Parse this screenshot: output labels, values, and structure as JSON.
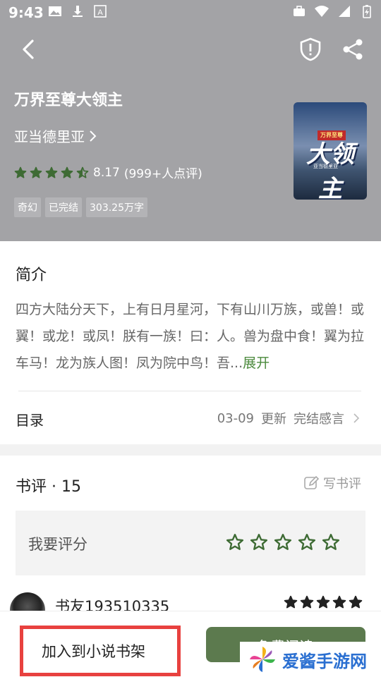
{
  "status_bar": {
    "time": "9:43"
  },
  "book": {
    "title": "万界至尊大领主",
    "author": "亚当德里亚",
    "rating_value": "8.17",
    "rating_count": "(999+人点评)",
    "rating_stars": 4.5,
    "tags": [
      "奇幻",
      "已完结",
      "303.25万字"
    ],
    "cover": {
      "badge": "万界至尊",
      "title": "大领主",
      "subtitle": "亚当德里亚"
    }
  },
  "intro": {
    "heading": "简介",
    "text": "四方大陆分天下，上有日月星河，下有山川万族，或兽！或翼！或龙！或凤！朕有一族！曰：人。兽为盘中食！翼为拉车马！龙为族人图！凤为院中鸟！吾...",
    "expand_label": "展开"
  },
  "toc": {
    "label": "目录",
    "date": "03-09",
    "update_label": "更新",
    "latest_chapter": "完结感言"
  },
  "reviews": {
    "heading": "书评 · 15",
    "write_label": "写书评",
    "rate_label": "我要评分",
    "first_comment": {
      "user": "书友193510335",
      "stars": 5
    }
  },
  "bottom_bar": {
    "add_shelf_label": "加入到小说书架",
    "read_label": "免费阅读"
  },
  "watermark": {
    "text": "爱酱手游网"
  },
  "colors": {
    "header_bg": "#a3a3a6",
    "accent_green": "#4b8a3c",
    "star_green": "#3e6b34",
    "read_button": "#5c7a4e",
    "highlight_red": "#e8413f"
  }
}
